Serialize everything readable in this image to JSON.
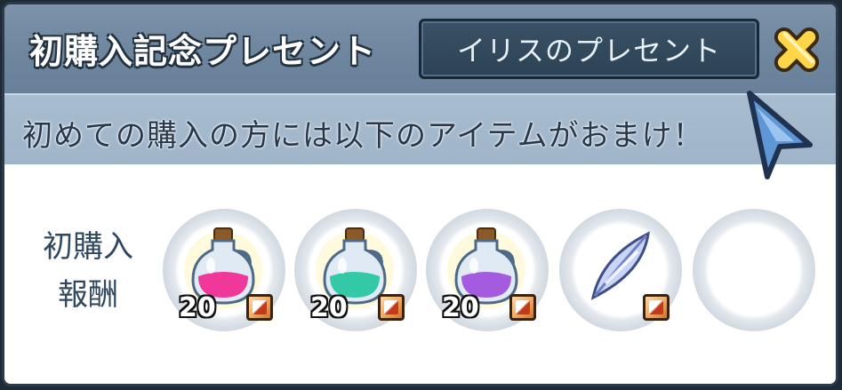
{
  "window": {
    "title": "初購入記念プレセント",
    "iris_button_label": "イリスのプレセント",
    "close_icon": "x-close-icon"
  },
  "banner": {
    "text": "初めての購入の方には以下のアイテムがおまけ！"
  },
  "rewards": {
    "label_line1": "初購入",
    "label_line2": "報酬",
    "items": [
      {
        "icon": "pink-potion-icon",
        "count": "20",
        "color": "#f0389a"
      },
      {
        "icon": "teal-potion-icon",
        "count": "20",
        "color": "#33c9a6"
      },
      {
        "icon": "purple-potion-icon",
        "count": "20",
        "color": "#a45be0"
      },
      {
        "icon": "feather-icon",
        "count": "",
        "color": "#8fa3e6"
      },
      {
        "icon": "empty-slot",
        "count": "",
        "color": ""
      }
    ]
  },
  "colors": {
    "titlebar": "#6d859d",
    "subbar": "#a9bdd0",
    "button": "#2c4154",
    "close": "#ffd54a"
  }
}
